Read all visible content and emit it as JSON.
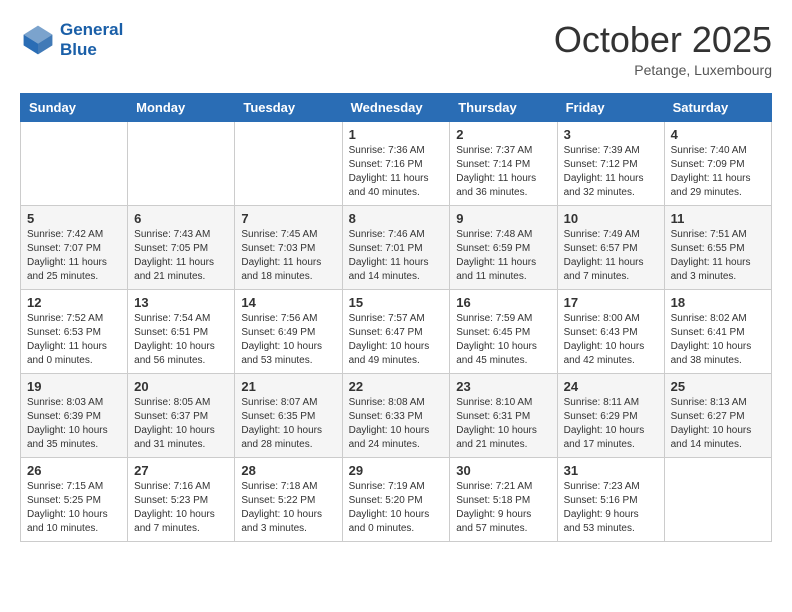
{
  "header": {
    "logo_line1": "General",
    "logo_line2": "Blue",
    "month": "October 2025",
    "location": "Petange, Luxembourg"
  },
  "weekdays": [
    "Sunday",
    "Monday",
    "Tuesday",
    "Wednesday",
    "Thursday",
    "Friday",
    "Saturday"
  ],
  "weeks": [
    [
      {
        "day": "",
        "info": ""
      },
      {
        "day": "",
        "info": ""
      },
      {
        "day": "",
        "info": ""
      },
      {
        "day": "1",
        "info": "Sunrise: 7:36 AM\nSunset: 7:16 PM\nDaylight: 11 hours\nand 40 minutes."
      },
      {
        "day": "2",
        "info": "Sunrise: 7:37 AM\nSunset: 7:14 PM\nDaylight: 11 hours\nand 36 minutes."
      },
      {
        "day": "3",
        "info": "Sunrise: 7:39 AM\nSunset: 7:12 PM\nDaylight: 11 hours\nand 32 minutes."
      },
      {
        "day": "4",
        "info": "Sunrise: 7:40 AM\nSunset: 7:09 PM\nDaylight: 11 hours\nand 29 minutes."
      }
    ],
    [
      {
        "day": "5",
        "info": "Sunrise: 7:42 AM\nSunset: 7:07 PM\nDaylight: 11 hours\nand 25 minutes."
      },
      {
        "day": "6",
        "info": "Sunrise: 7:43 AM\nSunset: 7:05 PM\nDaylight: 11 hours\nand 21 minutes."
      },
      {
        "day": "7",
        "info": "Sunrise: 7:45 AM\nSunset: 7:03 PM\nDaylight: 11 hours\nand 18 minutes."
      },
      {
        "day": "8",
        "info": "Sunrise: 7:46 AM\nSunset: 7:01 PM\nDaylight: 11 hours\nand 14 minutes."
      },
      {
        "day": "9",
        "info": "Sunrise: 7:48 AM\nSunset: 6:59 PM\nDaylight: 11 hours\nand 11 minutes."
      },
      {
        "day": "10",
        "info": "Sunrise: 7:49 AM\nSunset: 6:57 PM\nDaylight: 11 hours\nand 7 minutes."
      },
      {
        "day": "11",
        "info": "Sunrise: 7:51 AM\nSunset: 6:55 PM\nDaylight: 11 hours\nand 3 minutes."
      }
    ],
    [
      {
        "day": "12",
        "info": "Sunrise: 7:52 AM\nSunset: 6:53 PM\nDaylight: 11 hours\nand 0 minutes."
      },
      {
        "day": "13",
        "info": "Sunrise: 7:54 AM\nSunset: 6:51 PM\nDaylight: 10 hours\nand 56 minutes."
      },
      {
        "day": "14",
        "info": "Sunrise: 7:56 AM\nSunset: 6:49 PM\nDaylight: 10 hours\nand 53 minutes."
      },
      {
        "day": "15",
        "info": "Sunrise: 7:57 AM\nSunset: 6:47 PM\nDaylight: 10 hours\nand 49 minutes."
      },
      {
        "day": "16",
        "info": "Sunrise: 7:59 AM\nSunset: 6:45 PM\nDaylight: 10 hours\nand 45 minutes."
      },
      {
        "day": "17",
        "info": "Sunrise: 8:00 AM\nSunset: 6:43 PM\nDaylight: 10 hours\nand 42 minutes."
      },
      {
        "day": "18",
        "info": "Sunrise: 8:02 AM\nSunset: 6:41 PM\nDaylight: 10 hours\nand 38 minutes."
      }
    ],
    [
      {
        "day": "19",
        "info": "Sunrise: 8:03 AM\nSunset: 6:39 PM\nDaylight: 10 hours\nand 35 minutes."
      },
      {
        "day": "20",
        "info": "Sunrise: 8:05 AM\nSunset: 6:37 PM\nDaylight: 10 hours\nand 31 minutes."
      },
      {
        "day": "21",
        "info": "Sunrise: 8:07 AM\nSunset: 6:35 PM\nDaylight: 10 hours\nand 28 minutes."
      },
      {
        "day": "22",
        "info": "Sunrise: 8:08 AM\nSunset: 6:33 PM\nDaylight: 10 hours\nand 24 minutes."
      },
      {
        "day": "23",
        "info": "Sunrise: 8:10 AM\nSunset: 6:31 PM\nDaylight: 10 hours\nand 21 minutes."
      },
      {
        "day": "24",
        "info": "Sunrise: 8:11 AM\nSunset: 6:29 PM\nDaylight: 10 hours\nand 17 minutes."
      },
      {
        "day": "25",
        "info": "Sunrise: 8:13 AM\nSunset: 6:27 PM\nDaylight: 10 hours\nand 14 minutes."
      }
    ],
    [
      {
        "day": "26",
        "info": "Sunrise: 7:15 AM\nSunset: 5:25 PM\nDaylight: 10 hours\nand 10 minutes."
      },
      {
        "day": "27",
        "info": "Sunrise: 7:16 AM\nSunset: 5:23 PM\nDaylight: 10 hours\nand 7 minutes."
      },
      {
        "day": "28",
        "info": "Sunrise: 7:18 AM\nSunset: 5:22 PM\nDaylight: 10 hours\nand 3 minutes."
      },
      {
        "day": "29",
        "info": "Sunrise: 7:19 AM\nSunset: 5:20 PM\nDaylight: 10 hours\nand 0 minutes."
      },
      {
        "day": "30",
        "info": "Sunrise: 7:21 AM\nSunset: 5:18 PM\nDaylight: 9 hours\nand 57 minutes."
      },
      {
        "day": "31",
        "info": "Sunrise: 7:23 AM\nSunset: 5:16 PM\nDaylight: 9 hours\nand 53 minutes."
      },
      {
        "day": "",
        "info": ""
      }
    ]
  ]
}
